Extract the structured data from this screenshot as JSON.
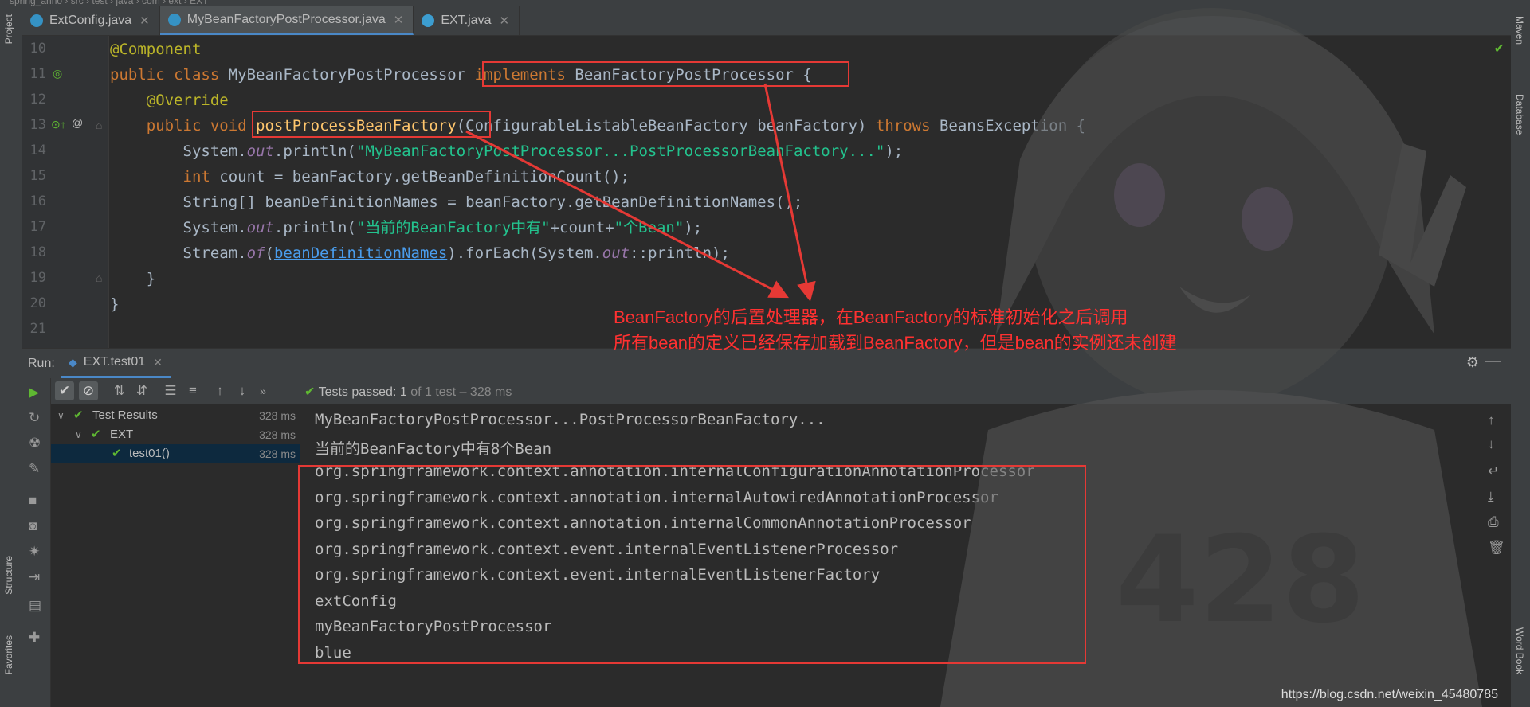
{
  "top": {
    "crumbs": "spring_anno  ›  src  ›  test  ›  java  ›  com  ›  ext  ›  EXT"
  },
  "left_strip": {
    "project": "Project",
    "structure": "Structure",
    "favorites": "Favorites"
  },
  "right_strip": {
    "maven": "Maven",
    "database": "Database",
    "word_book": "Word Book"
  },
  "tabs": [
    {
      "label": "ExtConfig.java",
      "active": false
    },
    {
      "label": "MyBeanFactoryPostProcessor.java",
      "active": true
    },
    {
      "label": "EXT.java",
      "active": false
    }
  ],
  "editor": {
    "line_numbers": [
      "10",
      "11",
      "12",
      "13",
      "14",
      "15",
      "16",
      "17",
      "18",
      "19",
      "20",
      "21"
    ],
    "lines": [
      {
        "a": "@Component"
      },
      {
        "a": "public class ",
        "b": "MyBeanFactoryPostProcessor ",
        "c": "implements ",
        "d": "BeanFactoryPostProcessor {"
      },
      {
        "a": "    @Override"
      },
      {
        "a": "    public void ",
        "b": "postProcessBeanFactory",
        "c": "(ConfigurableListableBeanFactory beanFactory) ",
        "d": "throws ",
        "e": "BeansException {"
      },
      {
        "a": "        System.",
        "b": "out",
        "c": ".println(",
        "d": "\"MyBeanFactoryPostProcessor...PostProcessorBeanFactory...\"",
        "e": ");"
      },
      {
        "a": "        ",
        "b": "int ",
        "c": "count = beanFactory.getBeanDefinitionCount();"
      },
      {
        "a": "        String[] beanDefinitionNames = beanFactory.getBeanDefinitionNames();"
      },
      {
        "a": "        System.",
        "b": "out",
        "c": ".println(",
        "d": "\"当前的BeanFactory中有\"",
        "e": "+count+",
        "f": "\"个Bean\"",
        "g": ");"
      },
      {
        "a": "        Stream.",
        "b": "of",
        "c": "(",
        "d": "beanDefinitionNames",
        "e": ").forEach(System.",
        "f": "out",
        "g": "::println);"
      },
      {
        "a": "    }"
      },
      {
        "a": "}"
      },
      {
        "a": ""
      }
    ]
  },
  "annotation": {
    "line1": "BeanFactory的后置处理器，在BeanFactory的标准初始化之后调用",
    "line2": "所有bean的定义已经保存加载到BeanFactory，但是bean的实例还未创建"
  },
  "run": {
    "label": "Run:",
    "tab": "EXT.test01",
    "status_prefix": "Tests passed:",
    "status_count": "1",
    "status_rest": "of 1 test – 328 ms",
    "tree": [
      {
        "name": "Test Results",
        "ms": "328 ms"
      },
      {
        "name": "EXT",
        "ms": "328 ms"
      },
      {
        "name": "test01()",
        "ms": "328 ms"
      }
    ],
    "console": [
      "MyBeanFactoryPostProcessor...PostProcessorBeanFactory...",
      "当前的BeanFactory中有8个Bean",
      "org.springframework.context.annotation.internalConfigurationAnnotationProcessor",
      "org.springframework.context.annotation.internalAutowiredAnnotationProcessor",
      "org.springframework.context.annotation.internalCommonAnnotationProcessor",
      "org.springframework.context.event.internalEventListenerProcessor",
      "org.springframework.context.event.internalEventListenerFactory",
      "extConfig",
      "myBeanFactoryPostProcessor",
      "blue"
    ]
  },
  "watermark": "https://blog.csdn.net/weixin_45480785",
  "colors": {
    "annotation_red": "#e53935",
    "pass_green": "#5fb832",
    "tab_accent": "#4a88c7"
  },
  "icons": [
    "java-class-icon",
    "run-icon",
    "check-icon",
    "stop-icon",
    "sort-icon",
    "expand-icon",
    "collapse-icon",
    "up-arrow-icon",
    "down-arrow-icon",
    "settings-icon",
    "minimize-icon",
    "rerun-icon",
    "debug-icon",
    "wrench-icon",
    "camera-icon",
    "gear-icon",
    "exit-icon",
    "layout-icon",
    "pin-icon",
    "wrap-icon",
    "scroll-end-icon",
    "print-icon",
    "trash-icon",
    "implements-icon",
    "override-icon"
  ]
}
